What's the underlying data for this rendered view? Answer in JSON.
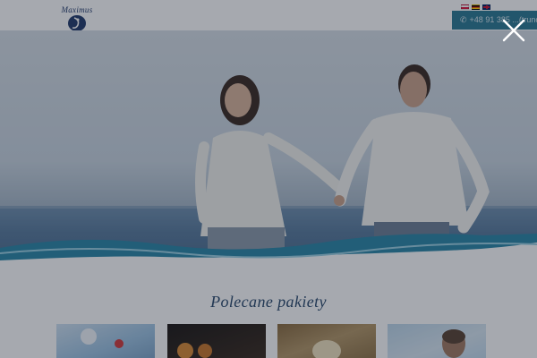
{
  "header": {
    "logo_text": "Maximus",
    "phone": "+48 91 385 ...(truncated)",
    "phone_icon": "phone-icon",
    "flags": [
      {
        "name": "flag-pl",
        "lang": "Polski"
      },
      {
        "name": "flag-de",
        "lang": "Deutsch"
      },
      {
        "name": "flag-en",
        "lang": "English"
      }
    ]
  },
  "hero": {
    "image": "couple running on beach"
  },
  "section": {
    "title": "Polecane pakiety",
    "packages": [
      {
        "id": "package-1"
      },
      {
        "id": "package-2"
      },
      {
        "id": "package-3"
      },
      {
        "id": "package-4"
      }
    ]
  },
  "overlay": {
    "close_icon": "close-icon"
  }
}
